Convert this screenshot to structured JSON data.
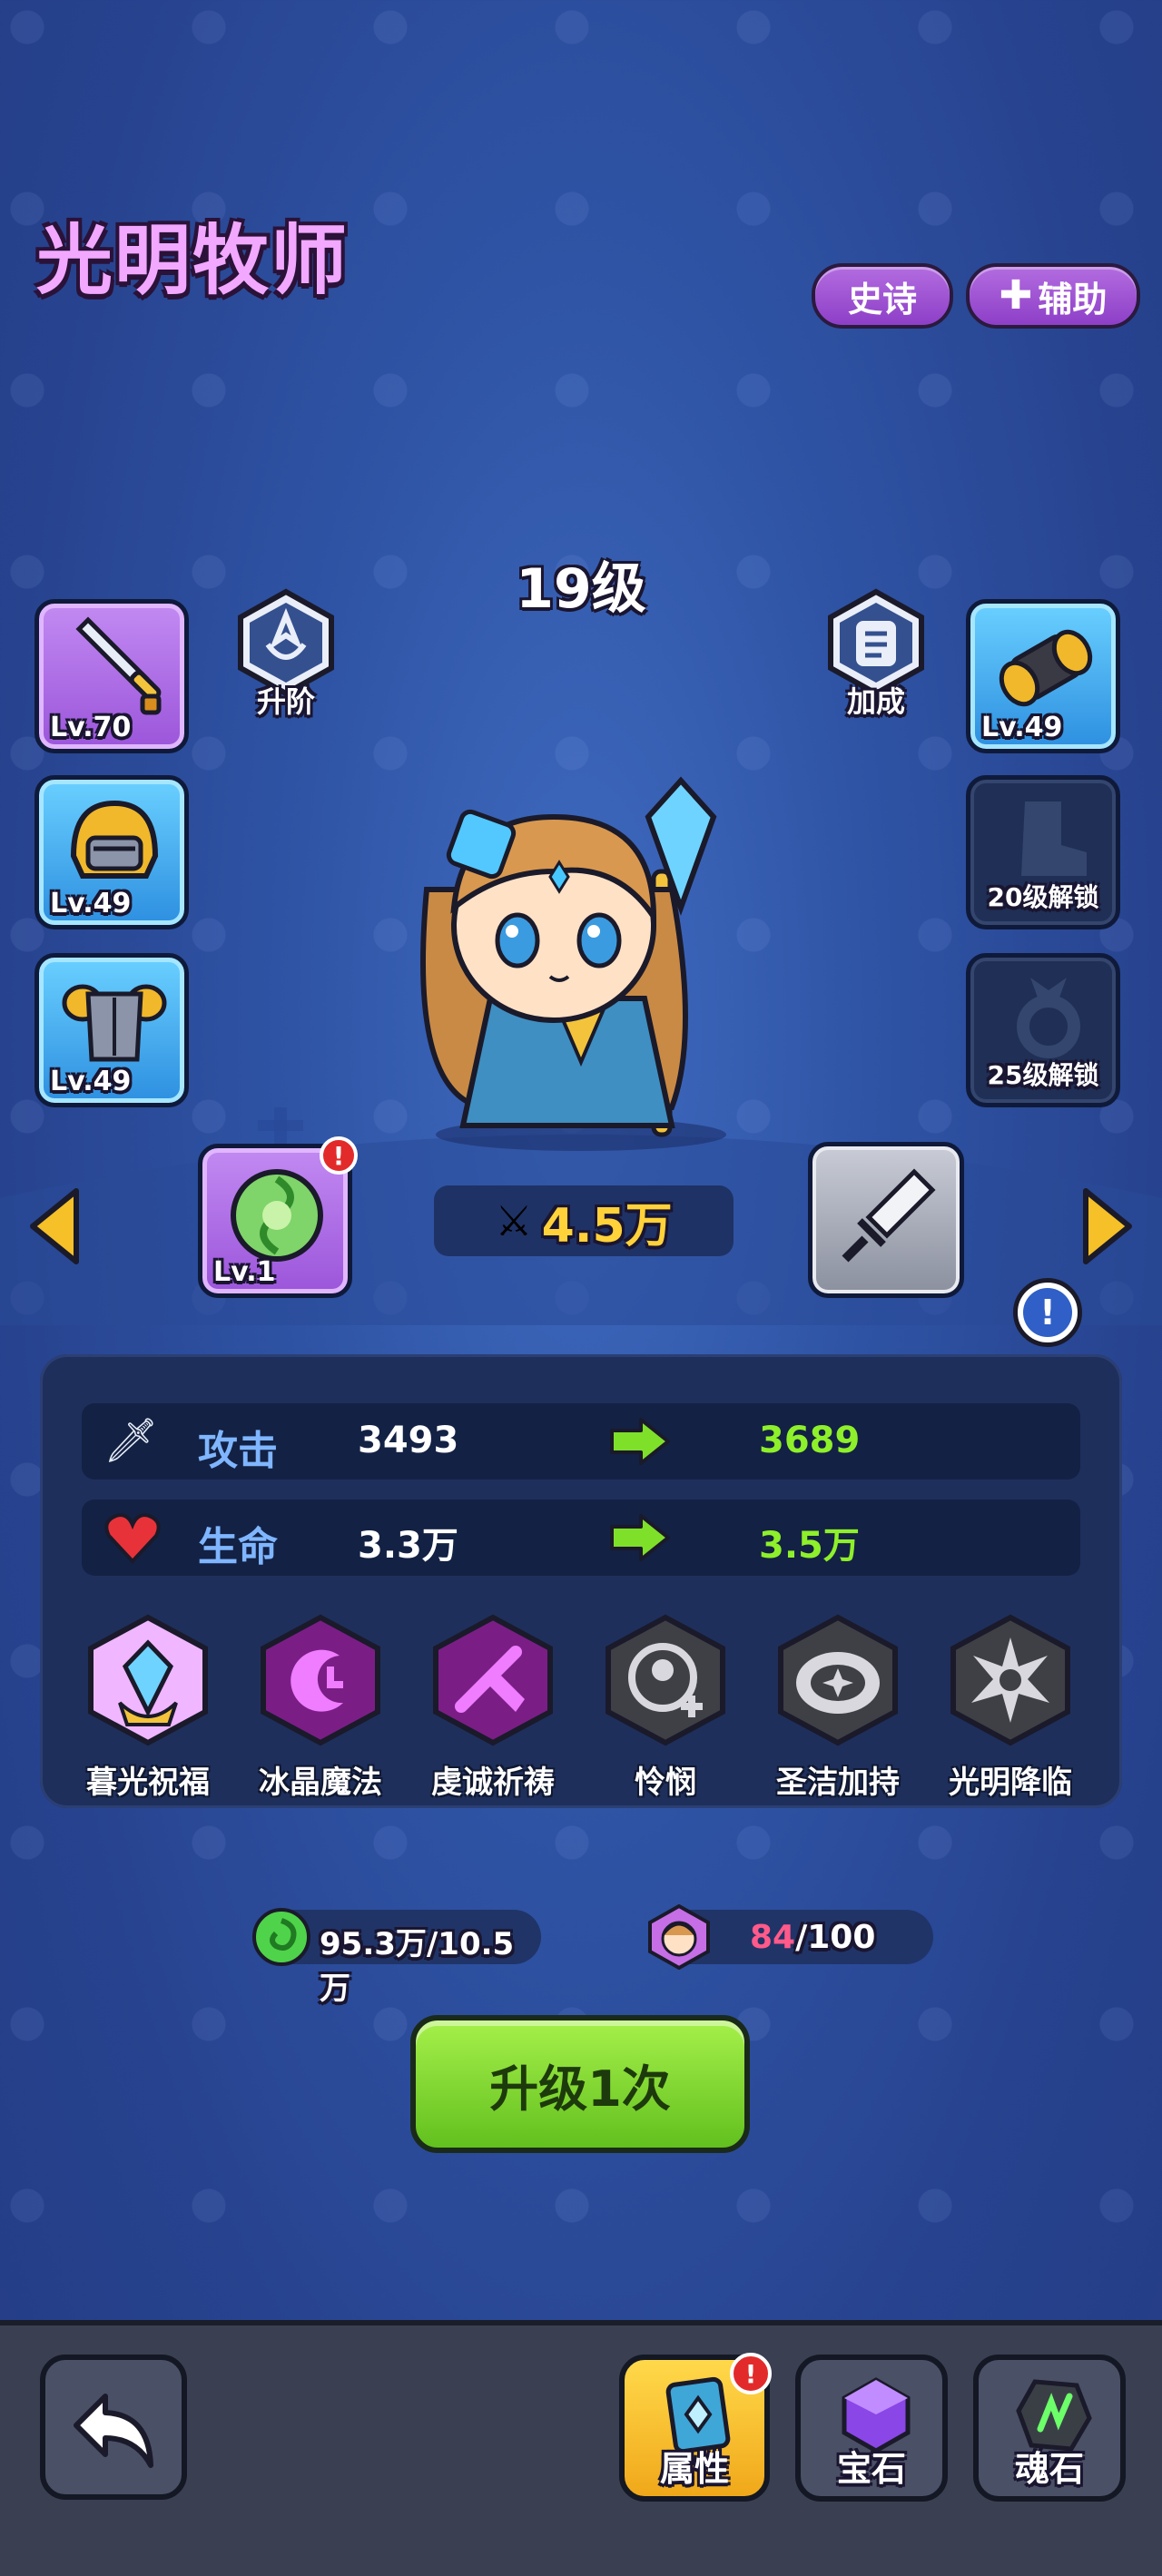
{
  "hero": {
    "name": "光明牧师",
    "rarity": "史诗",
    "role": "辅助",
    "level": "19级",
    "power": "4.5万"
  },
  "left_equipment": [
    {
      "level": "Lv.70",
      "icon": "sword-icon",
      "frame": "purple"
    },
    {
      "level": "Lv.49",
      "icon": "helmet-icon",
      "frame": "blue"
    },
    {
      "level": "Lv.49",
      "icon": "armor-icon",
      "frame": "blue"
    }
  ],
  "right_equipment": [
    {
      "level": "Lv.49",
      "icon": "bracer-icon",
      "frame": "blue"
    },
    {
      "lock_text": "20级解锁",
      "icon": "boot-icon"
    },
    {
      "lock_text": "25级解锁",
      "icon": "ring-icon"
    }
  ],
  "actions": {
    "ascend_label": "升阶",
    "bonus_label": "加成"
  },
  "pet": {
    "level": "Lv.1",
    "icon": "green-orb-icon"
  },
  "stats": [
    {
      "label": "攻击",
      "current": "3493",
      "next": "3689",
      "icon": "sword-icon"
    },
    {
      "label": "生命",
      "current": "3.3万",
      "next": "3.5万",
      "icon": "heart-icon"
    }
  ],
  "skills": [
    {
      "name": "暮光祝福",
      "icon": "shield-crystal-icon",
      "color": "#f0b6ff"
    },
    {
      "name": "冰晶魔法",
      "icon": "crescent-icon",
      "color": "#7a1e86"
    },
    {
      "name": "虔诚祈祷",
      "icon": "pray-icon",
      "color": "#7a1e86"
    },
    {
      "name": "怜悯",
      "icon": "heal-icon",
      "color": "#3f3f46"
    },
    {
      "name": "圣洁加持",
      "icon": "holy-icon",
      "color": "#3f3f46"
    },
    {
      "name": "光明降临",
      "icon": "burst-icon",
      "color": "#3f3f46"
    }
  ],
  "resources": {
    "essence": "95.3万/10.5万",
    "shards_have": "84",
    "shards_need": "/100"
  },
  "upgrade_button": "升级1次",
  "bottom_nav": {
    "back_icon": "back-arrow-icon",
    "tabs": [
      {
        "label": "属性",
        "icon": "book-icon"
      },
      {
        "label": "宝石",
        "icon": "gem-icon"
      },
      {
        "label": "魂石",
        "icon": "rune-stone-icon"
      }
    ]
  },
  "colors": {
    "background": "#2f54a5",
    "title": "#f2a8ff",
    "stat_increase": "#8ef02a",
    "upgrade_button": "#7fd42e"
  }
}
